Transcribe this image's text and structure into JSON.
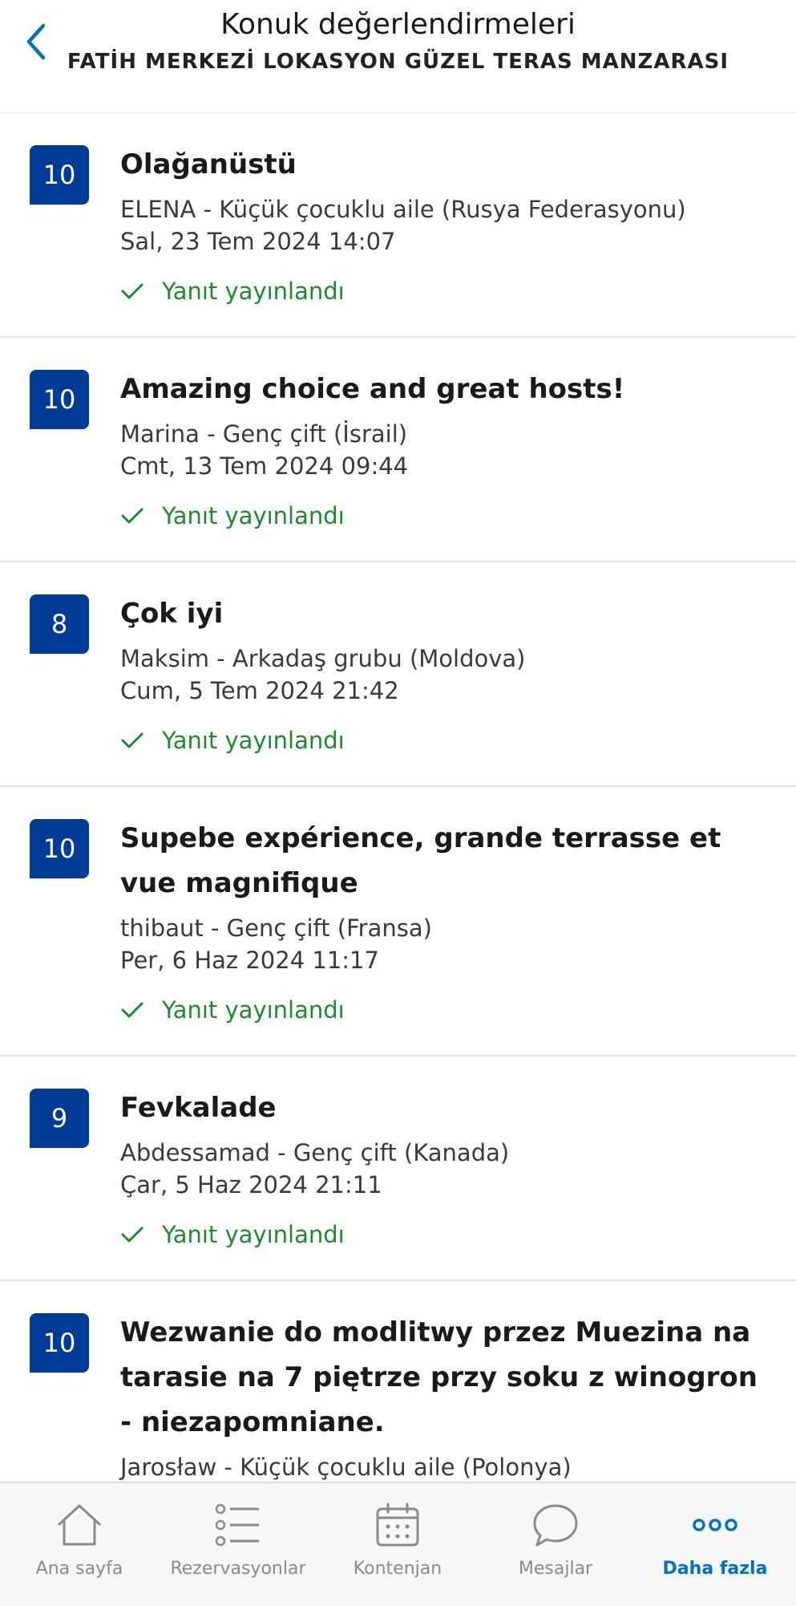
{
  "header": {
    "title": "Konuk değerlendirmeleri",
    "subtitle": "FATİH MERKEZİ LOKASYON GÜZEL TERAS MANZARASI",
    "back_icon": "chevron-left-icon"
  },
  "reviews": [
    {
      "score": "10",
      "title": "Olağanüstü",
      "guest": "ELENA - Küçük çocuklu aile (Rusya Federasyonu)",
      "date": "Sal, 23 Tem 2024 14:07",
      "status": "Yanıt yayınlandı"
    },
    {
      "score": "10",
      "title": "Amazing choice and great hosts!",
      "guest": "Marina - Genç çift (İsrail)",
      "date": "Cmt, 13 Tem 2024 09:44",
      "status": "Yanıt yayınlandı"
    },
    {
      "score": "8",
      "title": "Çok iyi",
      "guest": "Maksim - Arkadaş grubu (Moldova)",
      "date": "Cum, 5 Tem 2024 21:42",
      "status": "Yanıt yayınlandı"
    },
    {
      "score": "10",
      "title": "Supebe expérience, grande terrasse et vue magnifique",
      "guest": "thibaut - Genç çift (Fransa)",
      "date": "Per, 6 Haz 2024 11:17",
      "status": "Yanıt yayınlandı"
    },
    {
      "score": "9",
      "title": "Fevkalade",
      "guest": "Abdessamad - Genç çift (Kanada)",
      "date": "Çar, 5 Haz 2024 21:11",
      "status": "Yanıt yayınlandı"
    },
    {
      "score": "10",
      "title": "Wezwanie do modlitwy przez Muezina na tarasie na 7 piętrze przy soku z winogron - niezapomniane.",
      "guest": "Jarosław - Küçük çocuklu aile (Polonya)",
      "date": "",
      "status": ""
    }
  ],
  "tabbar": {
    "items": [
      {
        "label": "Ana sayfa",
        "icon": "home-icon"
      },
      {
        "label": "Rezervasyonlar",
        "icon": "list-icon"
      },
      {
        "label": "Kontenjan",
        "icon": "calendar-icon"
      },
      {
        "label": "Mesajlar",
        "icon": "chat-bubble-icon"
      },
      {
        "label": "Daha fazla",
        "icon": "more-dots-icon"
      }
    ],
    "active": "Daha fazla"
  },
  "colors": {
    "score_bg": "#003b95",
    "accent": "#0071c2",
    "status_green": "#1e8a2e"
  }
}
